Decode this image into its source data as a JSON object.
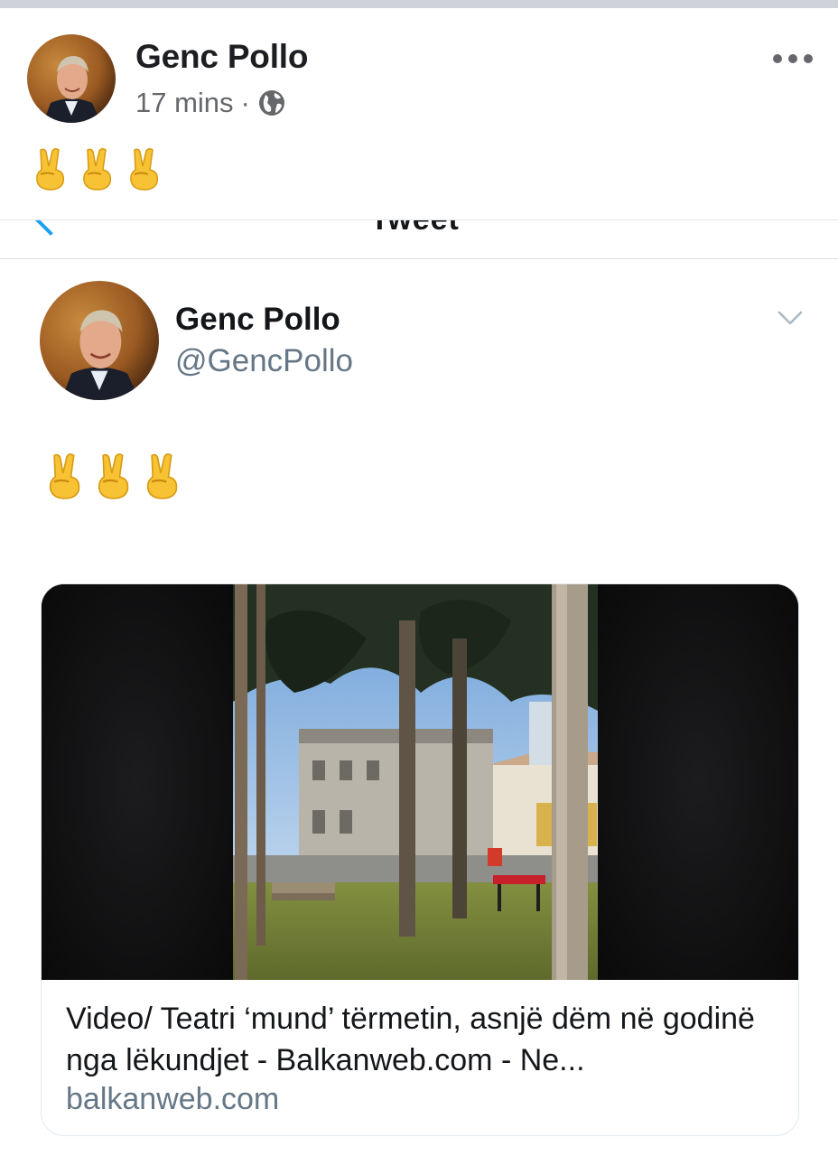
{
  "facebook_post": {
    "author": "Genc Pollo",
    "time": "17 mins",
    "separator": "·",
    "privacy_icon": "globe-icon",
    "more_icon": "more-options-icon",
    "text_emojis": [
      "victory-hand",
      "victory-hand",
      "victory-hand"
    ]
  },
  "shared_tweet": {
    "header_title": "Tweet",
    "author_name": "Genc Pollo",
    "author_handle": "@GencPollo",
    "chevron_icon": "chevron-down-icon",
    "text_emojis": [
      "victory-hand",
      "victory-hand",
      "victory-hand"
    ],
    "link_card": {
      "title": "Video/ Teatri ‘mund’ tërmetin, asnjë dëm në godinë nga lëkundjet - Balkanweb.com - Ne...",
      "domain": "balkanweb.com"
    }
  },
  "colors": {
    "facebook_text": "#1c1e21",
    "facebook_meta": "#65676b",
    "twitter_text": "#14171a",
    "twitter_secondary": "#657786",
    "twitter_blue": "#1da1f2"
  }
}
